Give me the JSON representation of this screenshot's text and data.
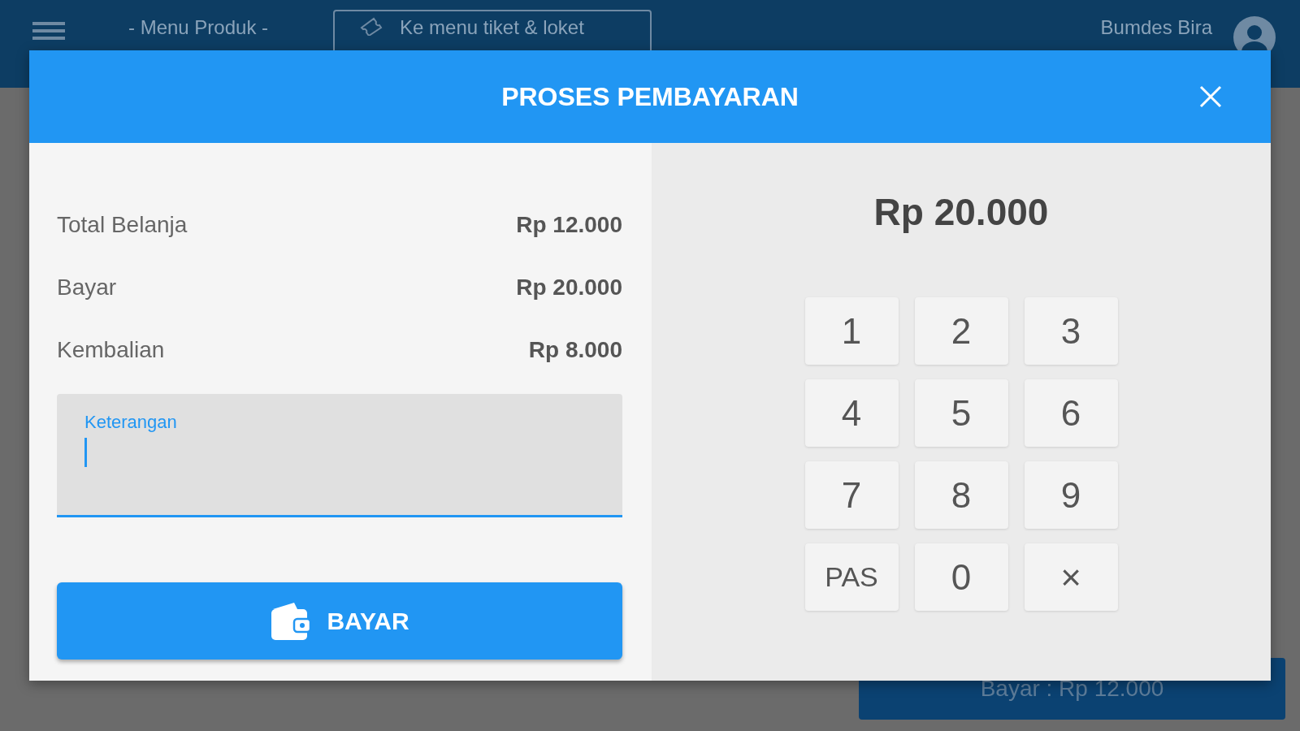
{
  "app_bar": {
    "menu_label": "- Menu Produk -",
    "ticket_button": "Ke menu tiket & loket",
    "user_name": "Bumdes Bira"
  },
  "dialog": {
    "title": "PROSES PEMBAYARAN",
    "summary": [
      {
        "label": "Total Belanja",
        "value": "Rp 12.000"
      },
      {
        "label": "Bayar",
        "value": "Rp 20.000"
      },
      {
        "label": "Kembalian",
        "value": "Rp 8.000"
      }
    ],
    "note_field": {
      "label": "Keterangan",
      "focused": true
    },
    "pay_button": "BAYAR",
    "amount_display": "Rp 20.000",
    "keypad": [
      {
        "kind": "digit",
        "label": "1"
      },
      {
        "kind": "digit",
        "label": "2"
      },
      {
        "kind": "digit",
        "label": "3"
      },
      {
        "kind": "digit",
        "label": "4"
      },
      {
        "kind": "digit",
        "label": "5"
      },
      {
        "kind": "digit",
        "label": "6"
      },
      {
        "kind": "digit",
        "label": "7"
      },
      {
        "kind": "digit",
        "label": "8"
      },
      {
        "kind": "digit",
        "label": "9"
      },
      {
        "kind": "word",
        "label": "PAS"
      },
      {
        "kind": "digit",
        "label": "0"
      },
      {
        "kind": "symbol",
        "label": "×"
      }
    ]
  },
  "checkout_button": "Bayar : Rp 12.000"
}
